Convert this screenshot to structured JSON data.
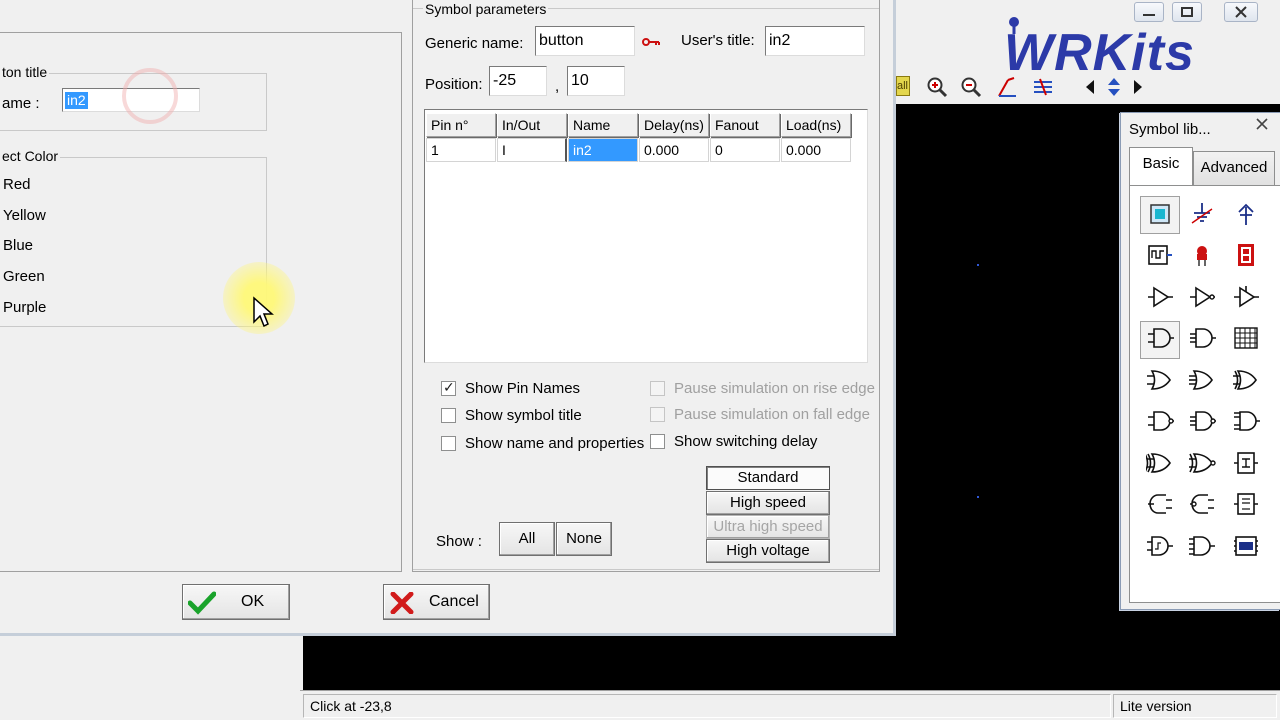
{
  "status_bar": {
    "coords": "Click at -23,8",
    "version": "Lite version"
  },
  "symbol_library": {
    "title": "Symbol lib...",
    "tabs": [
      {
        "label": "Basic",
        "active": true
      },
      {
        "label": "Advanced",
        "active": false
      }
    ],
    "icons": [
      "input-square-icon",
      "ground-icon",
      "vcc-icon",
      "clock-icon",
      "led-icon",
      "seven-seg-icon",
      "buffer-icon",
      "inverter-icon",
      "tristate-icon",
      "and-gate-icon",
      "and-gate-2-icon",
      "matrix-icon",
      "or-gate-icon",
      "or-gate-2-icon",
      "or-gate-3-icon",
      "nand-gate-icon",
      "nand-gate-2-icon",
      "nand-gate-3-icon",
      "xor-gate-icon",
      "xnor-gate-icon",
      "flipflop-icon",
      "nor-gate-icon",
      "nor-gate-2-icon",
      "register-icon",
      "schmitt-icon",
      "schmitt-2-icon",
      "rom-icon"
    ]
  },
  "dialog": {
    "left": {
      "button_title_group": "ton title",
      "name_label": "ame :",
      "name_value": "in2",
      "color_group": "ect Color",
      "colors": [
        "Red",
        "Yellow",
        "Blue",
        "Green",
        "Purple"
      ]
    },
    "symbol_parameters": {
      "group_title": "Symbol parameters",
      "generic_name_label": "Generic name:",
      "generic_name_value": "button",
      "users_title_label": "User's title:",
      "users_title_value": "in2",
      "position_label": "Position:",
      "position_x": "-25",
      "position_separator": ",",
      "position_y": "10",
      "pin_table": {
        "headers": [
          "Pin n°",
          "In/Out",
          "Name",
          "Delay(ns)",
          "Fanout",
          "Load(ns)"
        ],
        "rows": [
          [
            "1",
            "I",
            "in2",
            "0.000",
            "0",
            "0.000"
          ]
        ]
      },
      "options_left": [
        {
          "label": "Show Pin Names",
          "checked": true
        },
        {
          "label": "Show symbol title",
          "checked": false
        },
        {
          "label": "Show name and properties",
          "checked": false
        }
      ],
      "options_right": [
        {
          "label": "Pause simulation on rise edge",
          "checked": false,
          "disabled": true
        },
        {
          "label": "Pause simulation on fall edge",
          "checked": false,
          "disabled": true
        },
        {
          "label": "Show switching delay",
          "checked": false,
          "disabled": false
        }
      ],
      "show_label": "Show :",
      "show_all": "All",
      "show_none": "None",
      "speed_buttons": [
        "Standard",
        "High speed",
        "Ultra high speed",
        "High voltage"
      ]
    },
    "ok_label": "OK",
    "cancel_label": "Cancel"
  },
  "colors": {
    "selection": "#3399ff",
    "canvas": "#000000",
    "grid_dot": "#2f57d6",
    "ok_check": "#1aa32b",
    "cancel_x": "#d11b1b",
    "logo": "#2c3aa8"
  }
}
